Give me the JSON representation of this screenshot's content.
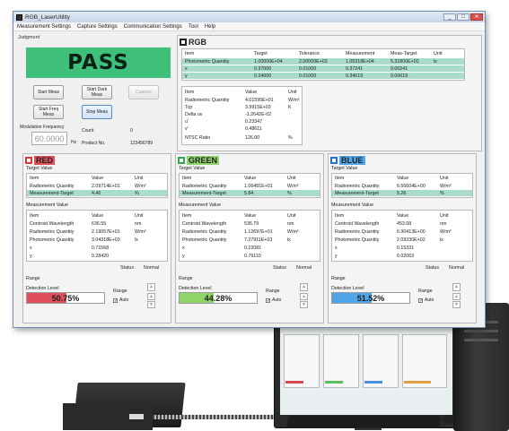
{
  "window": {
    "title": "RGB_LaserUtility",
    "controls": [
      "_",
      "□",
      "✕"
    ]
  },
  "menu": [
    "Measurement Settings",
    "Capture Settings",
    "Communication Settings",
    "Tool",
    "Help"
  ],
  "judgment": {
    "label": "Judgment",
    "result": "PASS"
  },
  "buttons": {
    "start_meas": "Start Meas",
    "start_dark_meas": "Start Dark Meas",
    "capture": "Capture",
    "start_freq_meas": "Start Freq Meas",
    "stop_meas": "Stop Meas"
  },
  "modulation": {
    "label": "Modulation Frequency",
    "value": "60.0000",
    "unit": "Hz"
  },
  "count": {
    "label": "Count",
    "value": "0"
  },
  "product": {
    "label": "Product No.",
    "value": "123456789"
  },
  "rgb": {
    "title": "RGB",
    "table1": {
      "headers": [
        "Item",
        "Target",
        "Tolerance",
        "Measurement",
        "Meas-Target",
        "Unit"
      ],
      "rows": [
        [
          "Photometric Quantity",
          "1.00000E+04",
          "2.00000E+03",
          "1.05318E+04",
          "5.31800E+02",
          "lx"
        ],
        [
          "x",
          "0.37000",
          "0.01000",
          "0.37241",
          "0.00241",
          ""
        ],
        [
          "y",
          "0.34000",
          "0.01000",
          "0.34619",
          "0.00619",
          ""
        ]
      ]
    },
    "table2": {
      "headers": [
        "Item",
        "Value",
        "Unit"
      ],
      "rows": [
        [
          "Radiometric Quantity",
          "4.01595E+01",
          "W/m²"
        ],
        [
          "Tcp",
          "3.9915E+03",
          "K"
        ],
        [
          "Delta uv",
          "-1.2642E-02",
          ""
        ],
        [
          "u'",
          "0.23347",
          ""
        ],
        [
          "v'",
          "0.48611",
          ""
        ],
        [
          "NTSC Ratio",
          "126.00",
          "%"
        ]
      ]
    }
  },
  "channels": [
    {
      "name": "RED",
      "color": "#d83a3a",
      "fill": "#e0505a",
      "level": "50.75%",
      "target_rows": [
        [
          "Radiometric Quantity",
          "2.09714E+01",
          "W/m²"
        ],
        [
          "Measurement-Target",
          "4.46",
          "%"
        ]
      ],
      "meas_rows": [
        [
          "Centroid Wavelength",
          "636.55",
          "nm"
        ],
        [
          "Radiometric Quantity",
          "2.19057E+01",
          "W/m²"
        ],
        [
          "Photometric Quantity",
          "3.04318E+03",
          "lx"
        ],
        [
          "x",
          "0.71568",
          ""
        ],
        [
          "y",
          "0.28420",
          ""
        ]
      ],
      "fill_pct": 50.75
    },
    {
      "name": "GREEN",
      "color": "#2fa84f",
      "fill": "#8fd36b",
      "level": "44.28%",
      "target_rows": [
        [
          "Radiometric Quantity",
          "1.06481E+01",
          "W/m²"
        ],
        [
          "Measurement-Target",
          "5.84",
          "%"
        ]
      ],
      "meas_rows": [
        [
          "Centroid Wavelength",
          "536.79",
          "nm"
        ],
        [
          "Radiometric Quantity",
          "1.12697E+01",
          "W/m²"
        ],
        [
          "Photometric Quantity",
          "7.27911E+03",
          "lx"
        ],
        [
          "x",
          "0.22081",
          ""
        ],
        [
          "y",
          "0.76110",
          ""
        ]
      ],
      "fill_pct": 44.28
    },
    {
      "name": "BLUE",
      "color": "#2a6fd0",
      "fill": "#4fa5e8",
      "level": "51.52%",
      "target_rows": [
        [
          "Radiometric Quantity",
          "6.56604E+00",
          "W/m²"
        ],
        [
          "Measurement-Target",
          "5.26",
          "%"
        ]
      ],
      "meas_rows": [
        [
          "Centroid Wavelength",
          "453.08",
          "nm"
        ],
        [
          "Radiometric Quantity",
          "6.90413E+00",
          "W/m²"
        ],
        [
          "Photometric Quantity",
          "2.09330E+02",
          "lx"
        ],
        [
          "x",
          "0.15331",
          ""
        ],
        [
          "y",
          "0.02063",
          ""
        ]
      ],
      "fill_pct": 51.52
    }
  ],
  "channel_labels": {
    "target_value": "Target Value",
    "measurement_value": "Measurement Value",
    "headers": [
      "Item",
      "Value",
      "Unit"
    ],
    "status": "Status",
    "normal": "Normal",
    "range": "Range",
    "detection_level": "Detection Level",
    "range_small": "Range",
    "auto": "Auto"
  }
}
